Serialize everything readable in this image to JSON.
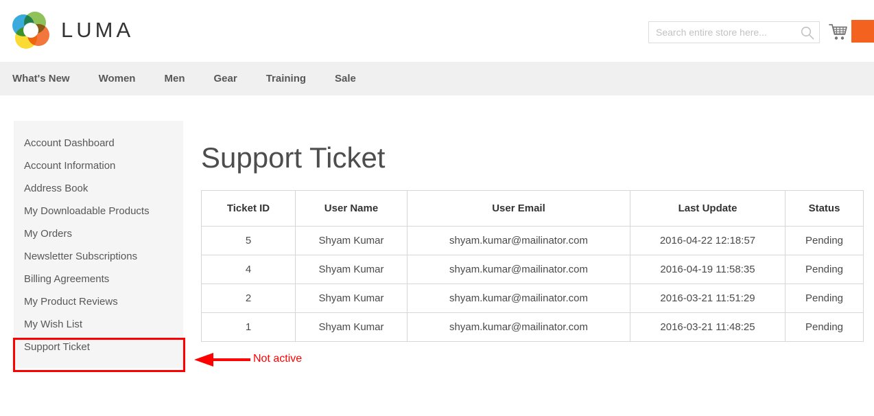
{
  "header": {
    "logo_text": "LUMA",
    "logo_icon": "luma-flower-logo",
    "search": {
      "placeholder": "Search entire store here...",
      "value": "",
      "icon": "search-icon"
    },
    "cart": {
      "icon": "shopping-cart-icon"
    },
    "accent_color": "#f4621f"
  },
  "nav": {
    "items": [
      {
        "label": "What's New"
      },
      {
        "label": "Women"
      },
      {
        "label": "Men"
      },
      {
        "label": "Gear"
      },
      {
        "label": "Training"
      },
      {
        "label": "Sale"
      }
    ]
  },
  "sidebar": {
    "items": [
      {
        "label": "Account Dashboard"
      },
      {
        "label": "Account Information"
      },
      {
        "label": "Address Book"
      },
      {
        "label": "My Downloadable Products"
      },
      {
        "label": "My Orders"
      },
      {
        "label": "Newsletter Subscriptions"
      },
      {
        "label": "Billing Agreements"
      },
      {
        "label": "My Product Reviews"
      },
      {
        "label": "My Wish List"
      },
      {
        "label": "Support Ticket"
      }
    ]
  },
  "main": {
    "title": "Support Ticket",
    "table": {
      "columns": [
        "Ticket ID",
        "User Name",
        "User Email",
        "Last Update",
        "Status"
      ],
      "rows": [
        {
          "ticket_id": "5",
          "user_name": "Shyam Kumar",
          "user_email": "shyam.kumar@mailinator.com",
          "last_update": "2016-04-22 12:18:57",
          "status": "Pending"
        },
        {
          "ticket_id": "4",
          "user_name": "Shyam Kumar",
          "user_email": "shyam.kumar@mailinator.com",
          "last_update": "2016-04-19 11:58:35",
          "status": "Pending"
        },
        {
          "ticket_id": "2",
          "user_name": "Shyam Kumar",
          "user_email": "shyam.kumar@mailinator.com",
          "last_update": "2016-03-21 11:51:29",
          "status": "Pending"
        },
        {
          "ticket_id": "1",
          "user_name": "Shyam Kumar",
          "user_email": "shyam.kumar@mailinator.com",
          "last_update": "2016-03-21 11:48:25",
          "status": "Pending"
        }
      ]
    }
  },
  "annotation": {
    "label": "Not active",
    "color": "#ff0000",
    "target": "Support Ticket"
  }
}
